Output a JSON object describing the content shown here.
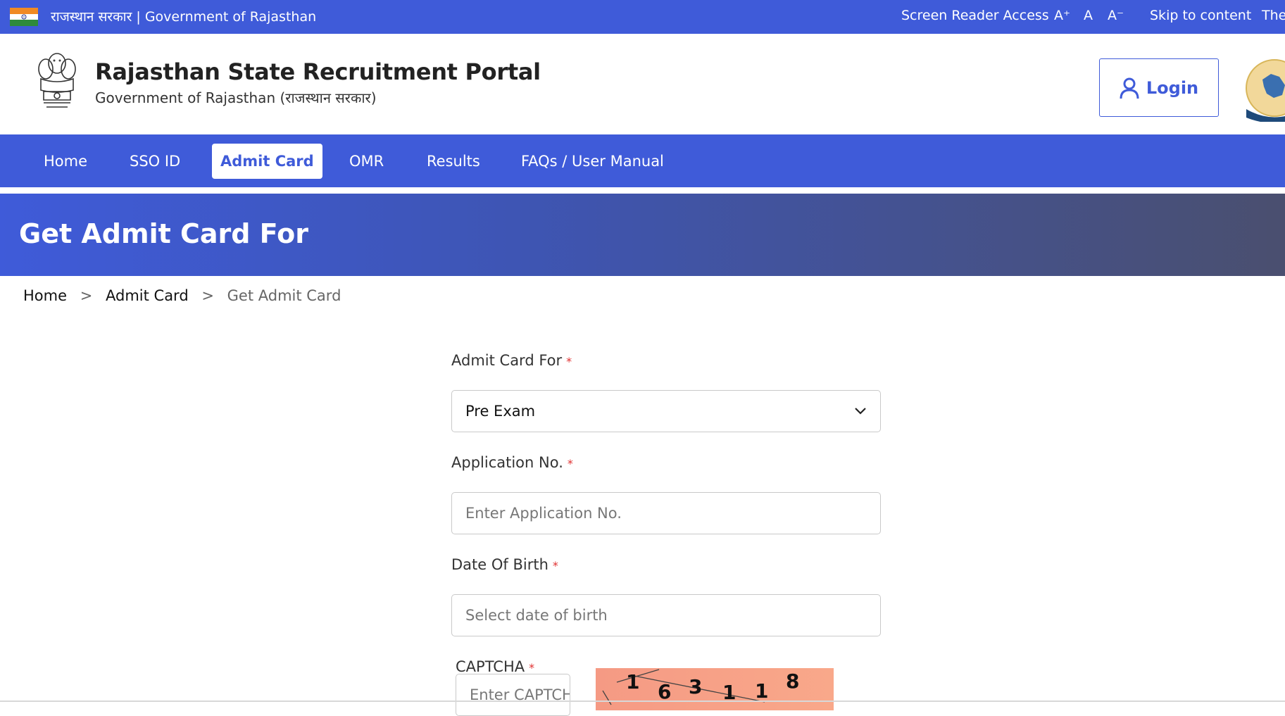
{
  "topbar": {
    "title": "राजस्थान सरकार | Government of Rajasthan",
    "screen_reader": "Screen Reader Access",
    "font_increase": "A⁺",
    "font_normal": "A",
    "font_decrease": "A⁻",
    "skip": "Skip to content",
    "theme": "The"
  },
  "header": {
    "title": "Rajasthan State Recruitment Portal",
    "subtitle": "Government of Rajasthan (राजस्थान सरकार)",
    "login_label": "Login"
  },
  "nav": {
    "items": [
      {
        "label": "Home"
      },
      {
        "label": "SSO ID"
      },
      {
        "label": "Admit Card"
      },
      {
        "label": "OMR"
      },
      {
        "label": "Results"
      },
      {
        "label": "FAQs / User Manual"
      }
    ]
  },
  "hero": {
    "title": "Get Admit Card For"
  },
  "breadcrumb": {
    "home": "Home",
    "section": "Admit Card",
    "current": "Get Admit Card",
    "separator": ">"
  },
  "form": {
    "admit_card_for": {
      "label": "Admit Card For",
      "value": "Pre Exam"
    },
    "application_no": {
      "label": "Application No.",
      "placeholder": "Enter Application No."
    },
    "dob": {
      "label": "Date Of Birth",
      "placeholder": "Select date of birth"
    },
    "captcha": {
      "label": "CAPTCHA",
      "placeholder": "Enter CAPTCHA",
      "code": [
        "1",
        "6",
        "3",
        "1",
        "1",
        "8"
      ]
    },
    "required_mark": "*"
  },
  "colors": {
    "primary": "#3f5bd9",
    "required": "#e03030"
  }
}
